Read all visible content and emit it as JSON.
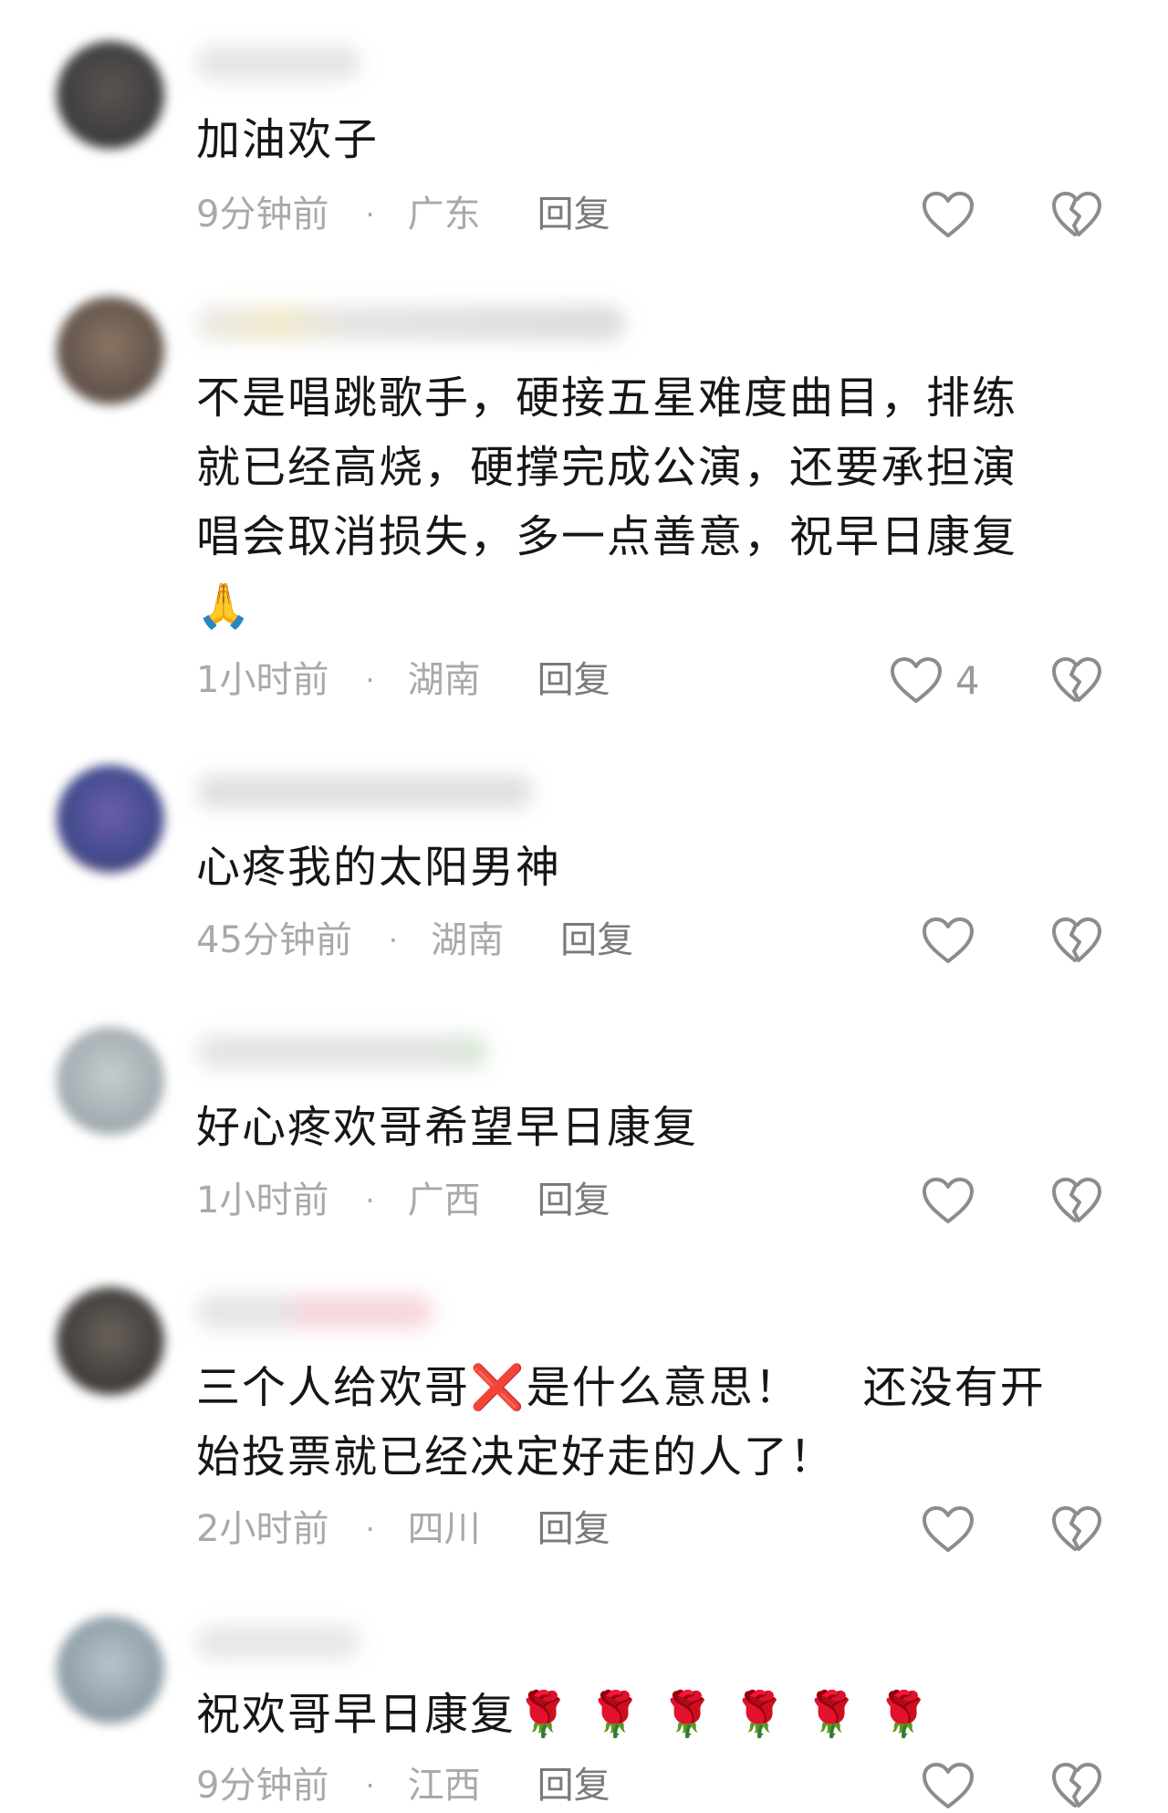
{
  "comments": [
    {
      "text": "加油欢子",
      "time": "9分钟前",
      "dot": "·",
      "location": "广东",
      "reply": "回复",
      "likes": ""
    },
    {
      "text": "不是唱跳歌手，硬接五星难度曲目，排练\n就已经高烧，硬撑完成公演，还要承担演\n唱会取消损失，多一点善意，祝早日康复\n🙏",
      "time": "1小时前",
      "dot": "·",
      "location": "湖南",
      "reply": "回复",
      "likes": "4"
    },
    {
      "text": "心疼我的太阳男神",
      "time": "45分钟前",
      "dot": "·",
      "location": "湖南",
      "reply": "回复",
      "likes": ""
    },
    {
      "text": "好心疼欢哥希望早日康复",
      "time": "1小时前",
      "dot": "·",
      "location": "广西",
      "reply": "回复",
      "likes": ""
    },
    {
      "text": "三个人给欢哥❌是什么意思！    还没有开\n始投票就已经决定好走的人了！",
      "time": "2小时前",
      "dot": "·",
      "location": "四川",
      "reply": "回复",
      "likes": ""
    },
    {
      "text": "祝欢哥早日康复🌹 🌹 🌹 🌹 🌹 🌹",
      "time": "9分钟前",
      "dot": "·",
      "location": "江西",
      "reply": "回复",
      "likes": ""
    }
  ],
  "icons": {
    "like": "heart-outline-icon",
    "dislike": "broken-heart-icon"
  },
  "colors": {
    "meta_text": "#a9a9a9",
    "reply_text": "#7a7a7a",
    "icon_stroke": "#8c8c8c"
  }
}
